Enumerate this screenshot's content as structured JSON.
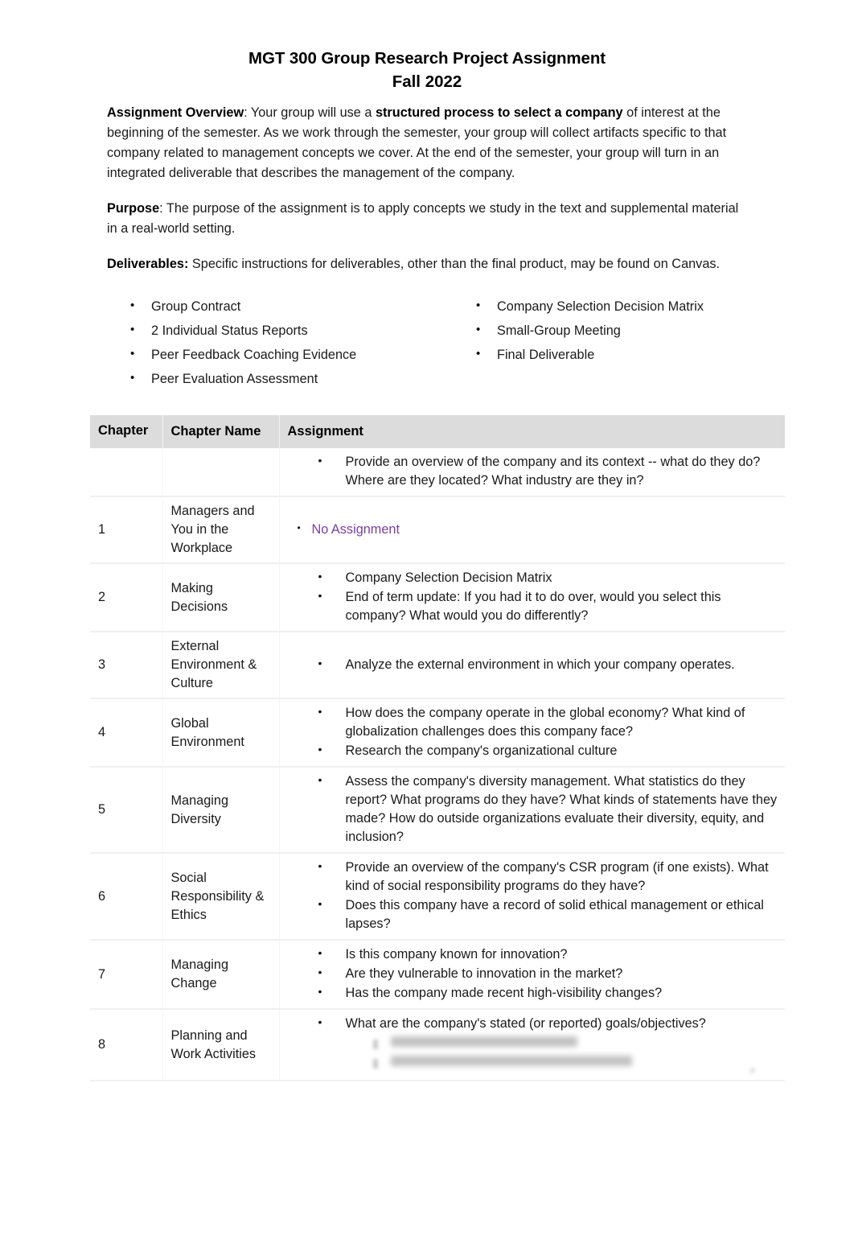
{
  "document": {
    "title": "MGT 300 Group Research Project Assignment",
    "subtitle": "Fall 2022"
  },
  "sections": {
    "overview": {
      "lead": "Assignment Overview",
      "lead_suffix": ": Your group will use a ",
      "emphasis": "structured process to select a company",
      "rest": " of interest at the beginning of the semester. As we work through the semester, your group will collect artifacts specific to that company related to management concepts we cover. At the end of the semester, your group will turn in an integrated deliverable that describes the management of the company."
    },
    "purpose": {
      "lead": "Purpose",
      "text": ": The purpose of the assignment is to apply concepts we study in the text and supplemental material in a real-world setting."
    },
    "deliverables": {
      "lead": "Deliverables:",
      "text": " Specific instructions for deliverables, other than the final product, may be found on Canvas.",
      "left_items": [
        "Group Contract",
        "2 Individual Status Reports",
        "Peer Feedback Coaching Evidence",
        "Peer Evaluation Assessment"
      ],
      "right_items": [
        "Company Selection Decision Matrix",
        "Small-Group Meeting",
        "Final Deliverable"
      ]
    }
  },
  "table": {
    "headers": {
      "chapter": "Chapter",
      "chapter_name": "Chapter Name",
      "assignment": "Assignment"
    },
    "intro_row": {
      "number": "",
      "name": "",
      "items": [
        "Provide an overview of the company and its context -- what do they do? Where are they located? What industry are they in?"
      ]
    },
    "rows": [
      {
        "number": "1",
        "name": "Managers and You in the Workplace",
        "items": [
          "No Assignment"
        ],
        "style": "no-assignment"
      },
      {
        "number": "2",
        "name": "Making Decisions",
        "items": [
          "Company Selection Decision Matrix",
          "End of term update: If you had it to do over, would you select this company? What would you do differently?"
        ]
      },
      {
        "number": "3",
        "name": "External Environment & Culture",
        "items": [
          "Analyze the external environment in which your company operates."
        ]
      },
      {
        "number": "4",
        "name": "Global Environment",
        "items": [
          "How does the company operate in the global economy? What kind of globalization challenges does this company face?",
          "Research the company's organizational culture"
        ]
      },
      {
        "number": "5",
        "name": "Managing Diversity",
        "items": [
          "Assess the company's diversity management. What statistics do they report? What programs do they have? What kinds of statements have they made? How do outside organizations evaluate their diversity, equity, and inclusion?"
        ]
      },
      {
        "number": "6",
        "name": "Social Responsibility & Ethics",
        "items": [
          "Provide an overview of the company's CSR program (if one exists). What kind of social responsibility programs do they have?",
          "Does this company have a record of solid ethical management or ethical lapses?"
        ]
      },
      {
        "number": "7",
        "name": "Managing Change",
        "items": [
          "Is this company known for innovation?",
          "Are they vulnerable to innovation in the market?",
          "Has the company made recent high-visibility changes?"
        ]
      },
      {
        "number": "8",
        "name": "Planning and Work Activities",
        "items": [
          "What are the company's stated (or reported) goals/objectives?"
        ],
        "redacted_sub_items": 2
      }
    ]
  },
  "colors": {
    "no_assignment": "#7b3fa0",
    "header_band": "#dcdcdc",
    "row_divider": "#f0f0f0",
    "text": "#1a1a1a"
  },
  "icons": {
    "bullet": "•"
  }
}
